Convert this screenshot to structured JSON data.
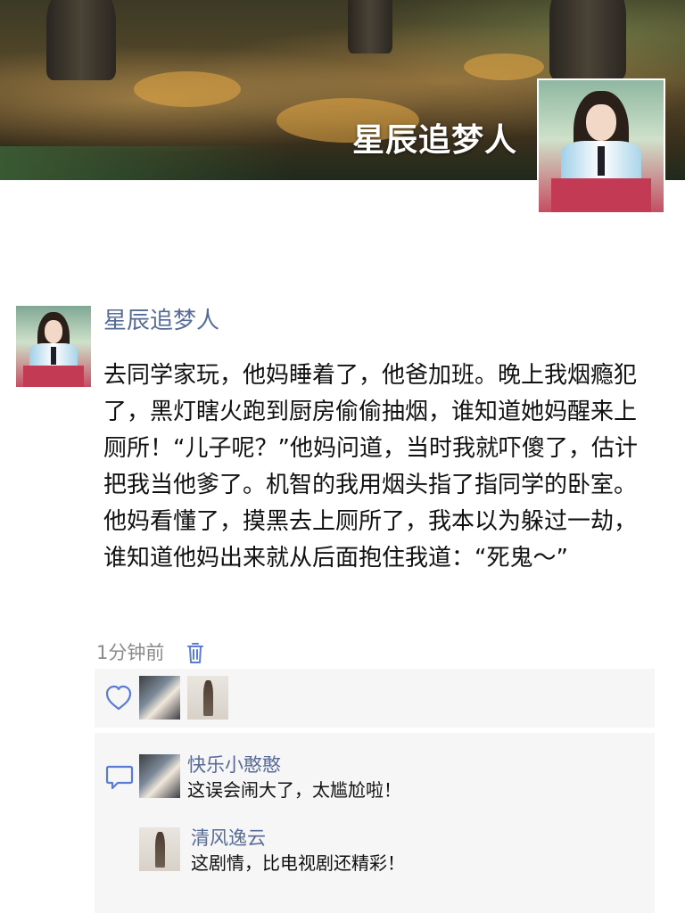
{
  "cover": {
    "title": "星辰追梦人",
    "avatar_icon": "profile-photo"
  },
  "post": {
    "author": "星辰追梦人",
    "content": "去同学家玩，他妈睡着了，他爸加班。晚上我烟瘾犯了，黑灯瞎火跑到厨房偷偷抽烟，谁知道她妈醒来上厕所！“儿子呢？”他妈问道，当时我就吓傻了，估计把我当他爹了。机智的我用烟头指了指同学的卧室。他妈看懂了，摸黑去上厕所了，我本以为躲过一劫，谁知道他妈出来就从后面抱住我道：“死鬼～”",
    "time": "1分钟前",
    "delete_icon": "trash-icon"
  },
  "likes": {
    "icon": "heart-icon",
    "count_shown": 2
  },
  "comments": {
    "icon": "comment-bubble-icon",
    "items": [
      {
        "name": "快乐小憨憨",
        "text": "这误会闹大了，太尴尬啦！"
      },
      {
        "name": "清风逸云",
        "text": "这剧情，比电视剧还精彩！"
      }
    ]
  },
  "colors": {
    "link_blue": "#576b95",
    "area_gray": "#f6f6f6",
    "icon_blue": "#5b7bd5"
  }
}
